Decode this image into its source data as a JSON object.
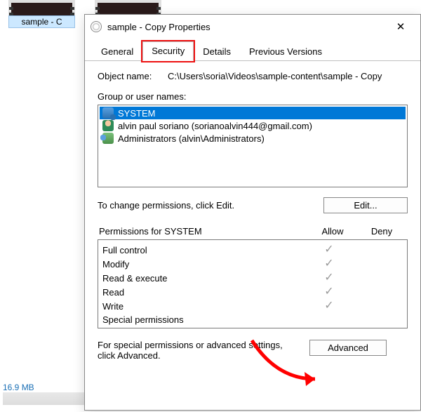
{
  "bg": {
    "file1_label": "sample - C",
    "file_size": "16.9 MB"
  },
  "window": {
    "title": "sample - Copy Properties",
    "close_glyph": "✕"
  },
  "tabs": {
    "general": "General",
    "security": "Security",
    "details": "Details",
    "previous": "Previous Versions"
  },
  "object": {
    "label": "Object name:",
    "path": "C:\\Users\\soria\\Videos\\sample-content\\sample - Copy"
  },
  "groups": {
    "label": "Group or user names:",
    "items": [
      {
        "name": "SYSTEM",
        "icon": "system",
        "selected": true
      },
      {
        "name": "alvin paul soriano (sorianoalvin444@gmail.com)",
        "icon": "user",
        "selected": false
      },
      {
        "name": "Administrators (alvin\\Administrators)",
        "icon": "admins",
        "selected": false
      }
    ]
  },
  "edit_hint": "To change permissions, click Edit.",
  "edit_btn": "Edit...",
  "perm_header": {
    "title": "Permissions for SYSTEM",
    "allow": "Allow",
    "deny": "Deny"
  },
  "perms": [
    {
      "name": "Full control",
      "allow": true,
      "deny": false
    },
    {
      "name": "Modify",
      "allow": true,
      "deny": false
    },
    {
      "name": "Read & execute",
      "allow": true,
      "deny": false
    },
    {
      "name": "Read",
      "allow": true,
      "deny": false
    },
    {
      "name": "Write",
      "allow": true,
      "deny": false
    },
    {
      "name": "Special permissions",
      "allow": false,
      "deny": false
    }
  ],
  "adv_hint": "For special permissions or advanced settings, click Advanced.",
  "adv_btn": "Advanced",
  "check_glyph": "✓"
}
